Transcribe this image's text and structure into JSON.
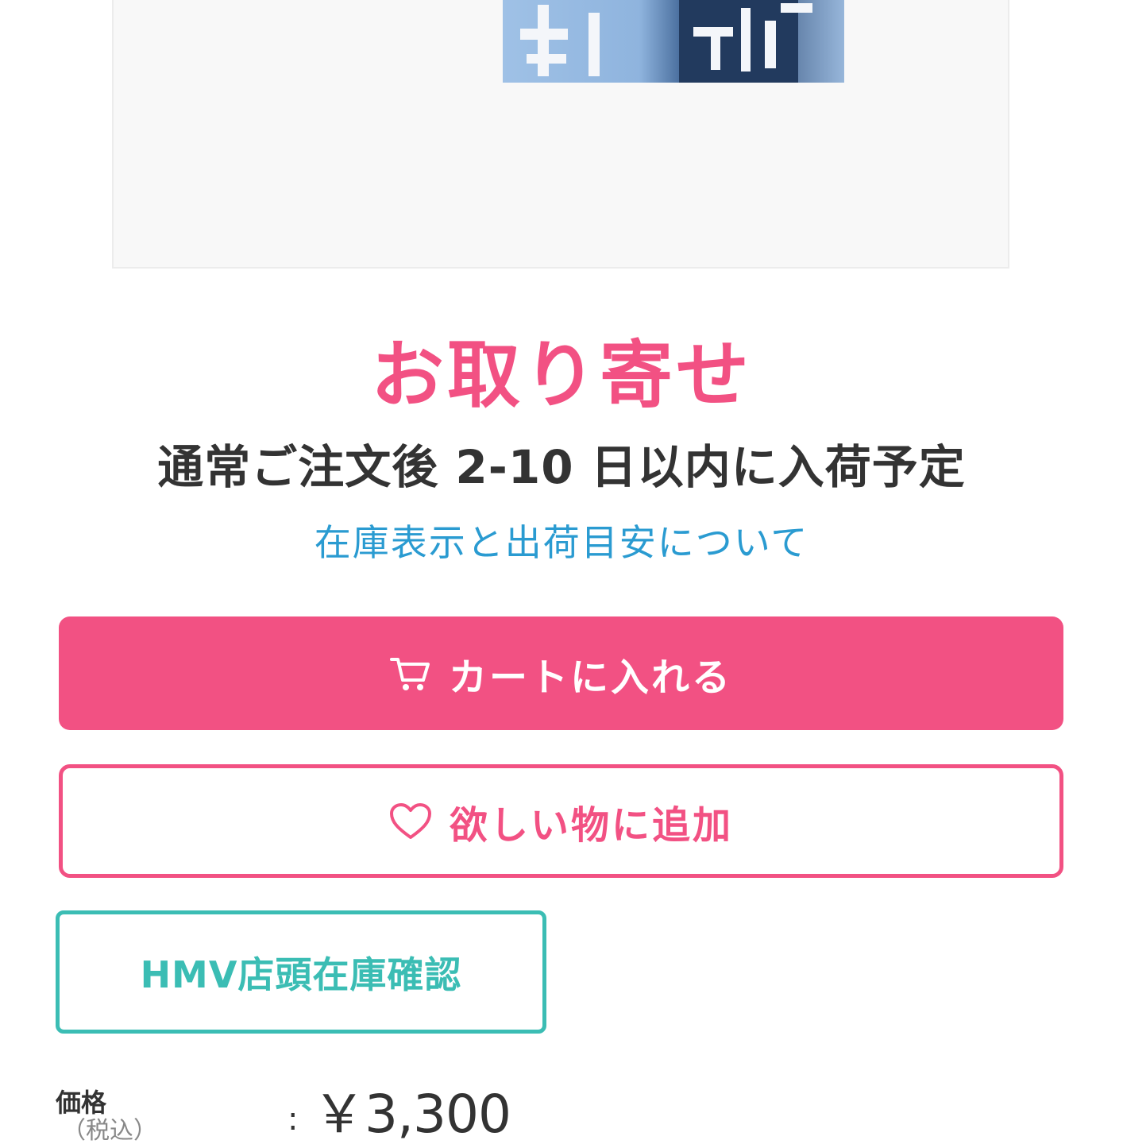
{
  "product": {
    "availability_title": "お取り寄せ",
    "shipping_note": "通常ご注文後 2-10 日以内に入荷予定",
    "stock_info_link": "在庫表示と出荷目安について"
  },
  "actions": {
    "add_to_cart_label": "カートに入れる",
    "add_to_cart_icon": "cart-icon",
    "wishlist_label": "欲しい物に追加",
    "wishlist_icon": "heart-icon",
    "store_stock_label": "HMV店頭在庫確認"
  },
  "price": {
    "label": "価格",
    "sub_label": "（税込）",
    "separator": ":",
    "value": "￥3,300"
  },
  "colors": {
    "accent_pink": "#f25183",
    "link_blue": "#2a9bd1",
    "store_teal": "#3bbdb4"
  }
}
